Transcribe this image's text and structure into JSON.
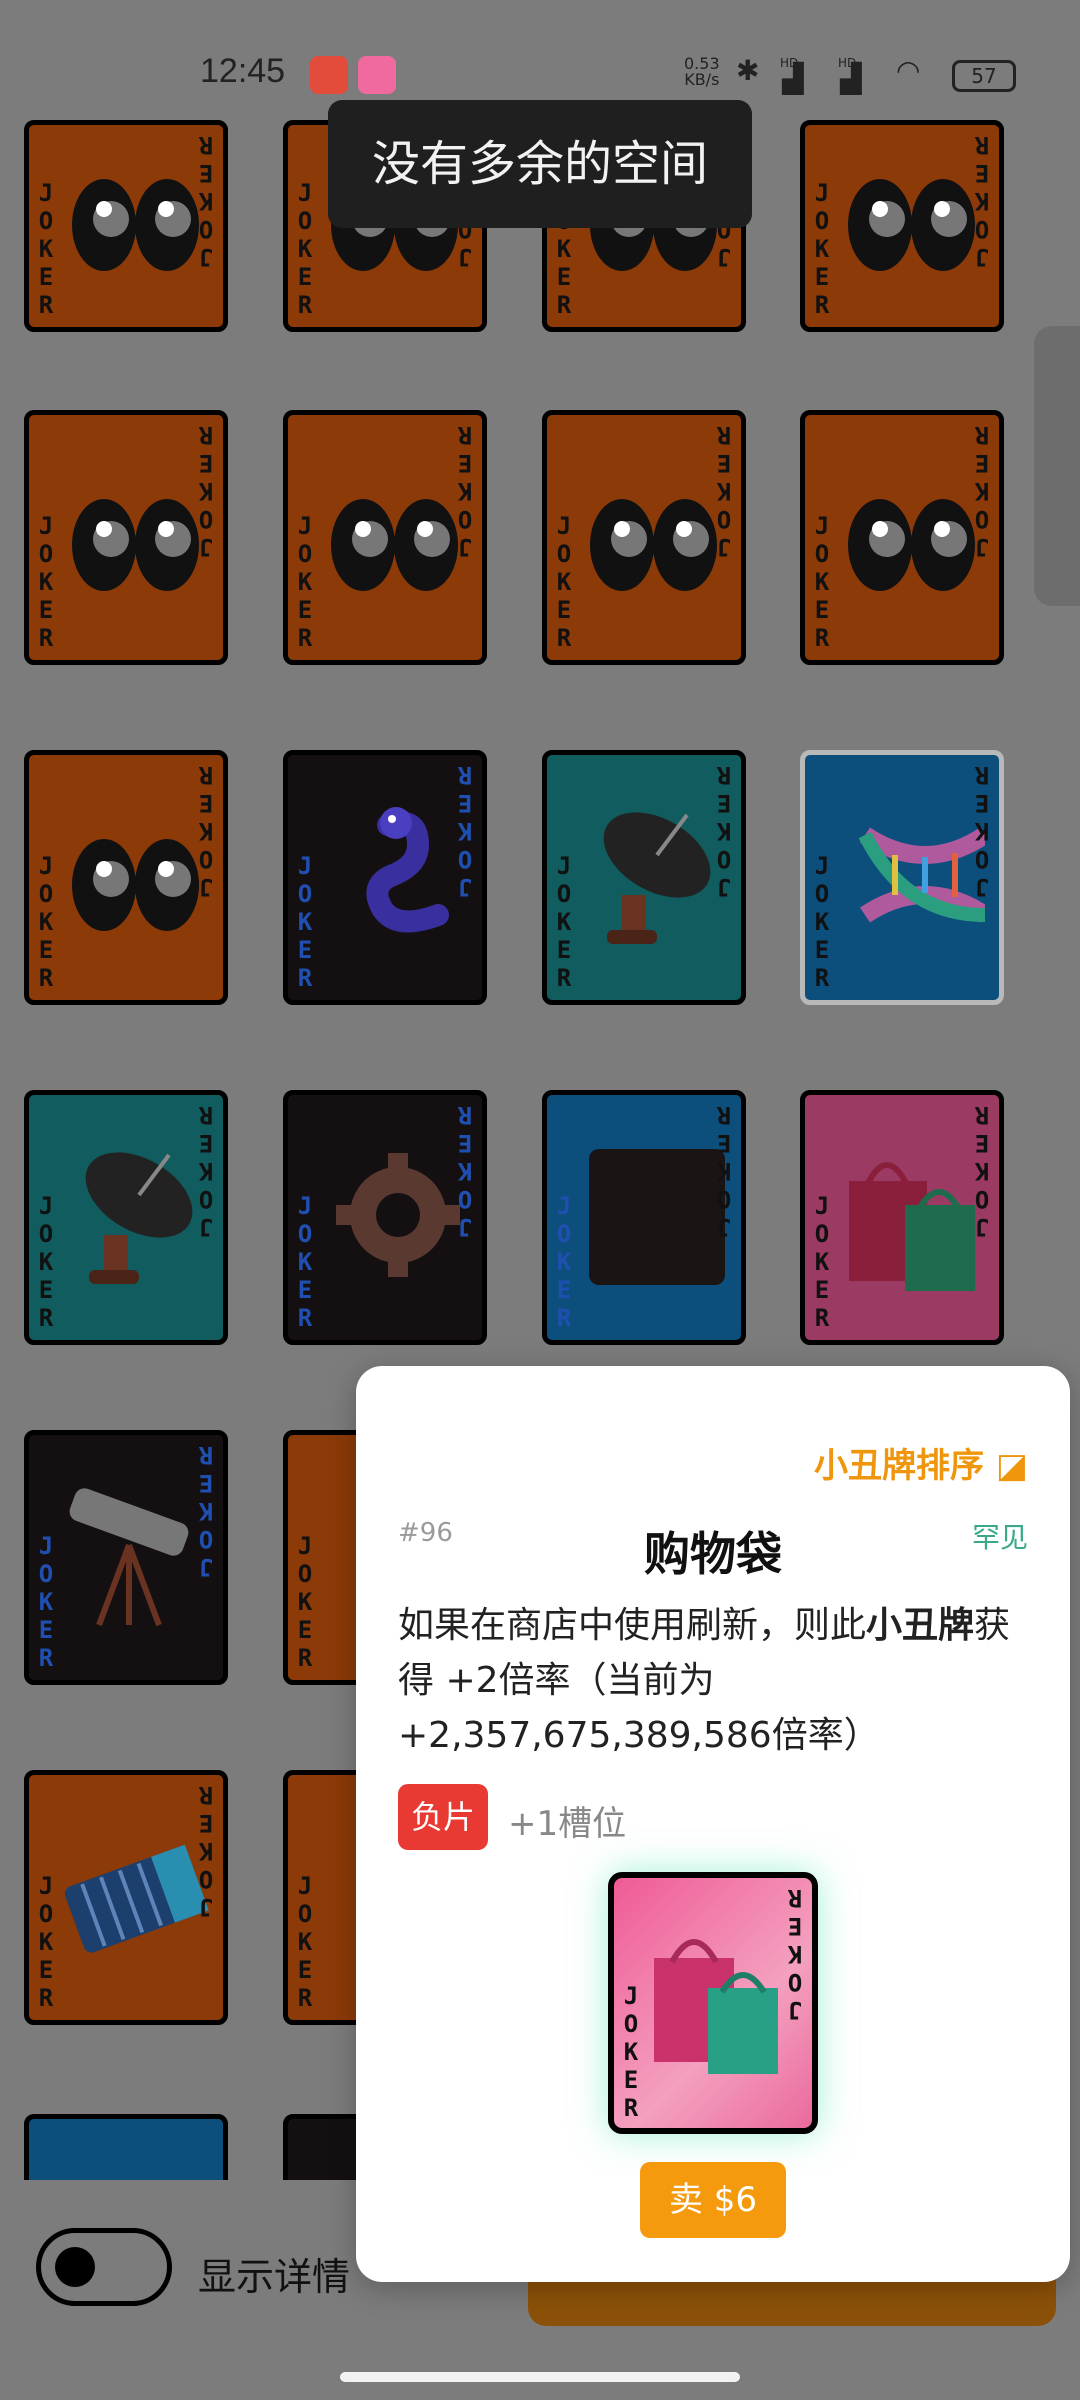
{
  "status_bar": {
    "time": "12:45",
    "net_speed_value": "0.53",
    "net_speed_unit": "KB/s",
    "signal1": "HD",
    "signal2": "HD",
    "battery": "57"
  },
  "toast": "没有多余的空间",
  "grid": {
    "joker_text": "JOKER",
    "cards": [
      {
        "theme": "eyes",
        "color": "orange"
      },
      {
        "theme": "eyes",
        "color": "orange"
      },
      {
        "theme": "eyes",
        "color": "orange"
      },
      {
        "theme": "eyes",
        "color": "orange"
      },
      {
        "theme": "eyes",
        "color": "orange"
      },
      {
        "theme": "eyes",
        "color": "orange"
      },
      {
        "theme": "eyes",
        "color": "orange"
      },
      {
        "theme": "eyes",
        "color": "orange"
      },
      {
        "theme": "eyes",
        "color": "orange"
      },
      {
        "theme": "snake",
        "color": "black"
      },
      {
        "theme": "satellite-dish",
        "color": "teal"
      },
      {
        "theme": "dna",
        "color": "blue"
      },
      {
        "theme": "satellite-dish",
        "color": "teal"
      },
      {
        "theme": "gear",
        "color": "black"
      },
      {
        "theme": "dark-square",
        "color": "blue"
      },
      {
        "theme": "shopping-bags",
        "color": "pink"
      },
      {
        "theme": "telescope",
        "color": "black"
      },
      {
        "theme": "partial",
        "color": "orange"
      },
      {
        "theme": "accordion",
        "color": "orange"
      },
      {
        "theme": "partial",
        "color": "orange"
      },
      {
        "theme": "partial",
        "color": "blue"
      },
      {
        "theme": "partial",
        "color": "black"
      }
    ]
  },
  "bottom": {
    "toggle_label": "显示详情"
  },
  "popup": {
    "sort_link": "小丑牌排序",
    "number": "#96",
    "title": "购物袋",
    "rarity": "罕见",
    "desc_part1": "如果在商店中使用刷新，则此",
    "desc_bold": "小丑牌",
    "desc_part2": "获得 +2倍率（当前为 +2,357,675,389,586倍率）",
    "negative_badge": "负片",
    "slot_text": "+1槽位",
    "sell_button": "卖 $6"
  },
  "colors": {
    "orange_card": "#8c3a08",
    "teal_card": "#115c5e",
    "blue_card": "#0c4f7d",
    "pink_card": "#9b3a62",
    "accent": "#f0960c",
    "rarity": "#3aa98b",
    "negative": "#e83a33"
  }
}
